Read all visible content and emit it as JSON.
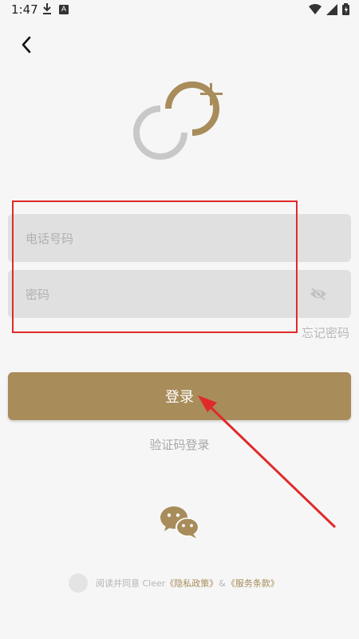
{
  "status_bar": {
    "time": "1:47",
    "notification_icons": [
      "download-icon",
      "a-app-icon"
    ],
    "system_icons": [
      "wifi-icon",
      "signal-icon",
      "battery-icon"
    ]
  },
  "back_icon": "chevron-left-icon",
  "logo_icon": "cleer-plus-logo",
  "form": {
    "phone_placeholder": "电话号码",
    "phone_value": "",
    "password_placeholder": "密码",
    "password_value": "",
    "forgot_password": "忘记密码"
  },
  "login_button": "登录",
  "sms_login": "验证码登录",
  "wechat_icon": "wechat-icon",
  "agreement": {
    "prefix": "阅读并同意 Cleer",
    "privacy_link": "《隐私政策》",
    "amp": "&",
    "terms_link": "《服务条款》"
  },
  "colors": {
    "accent": "#a88c5a",
    "annotation_red": "#e02a2a",
    "field_bg": "#e0e0e0",
    "background": "#f6f6f6"
  }
}
